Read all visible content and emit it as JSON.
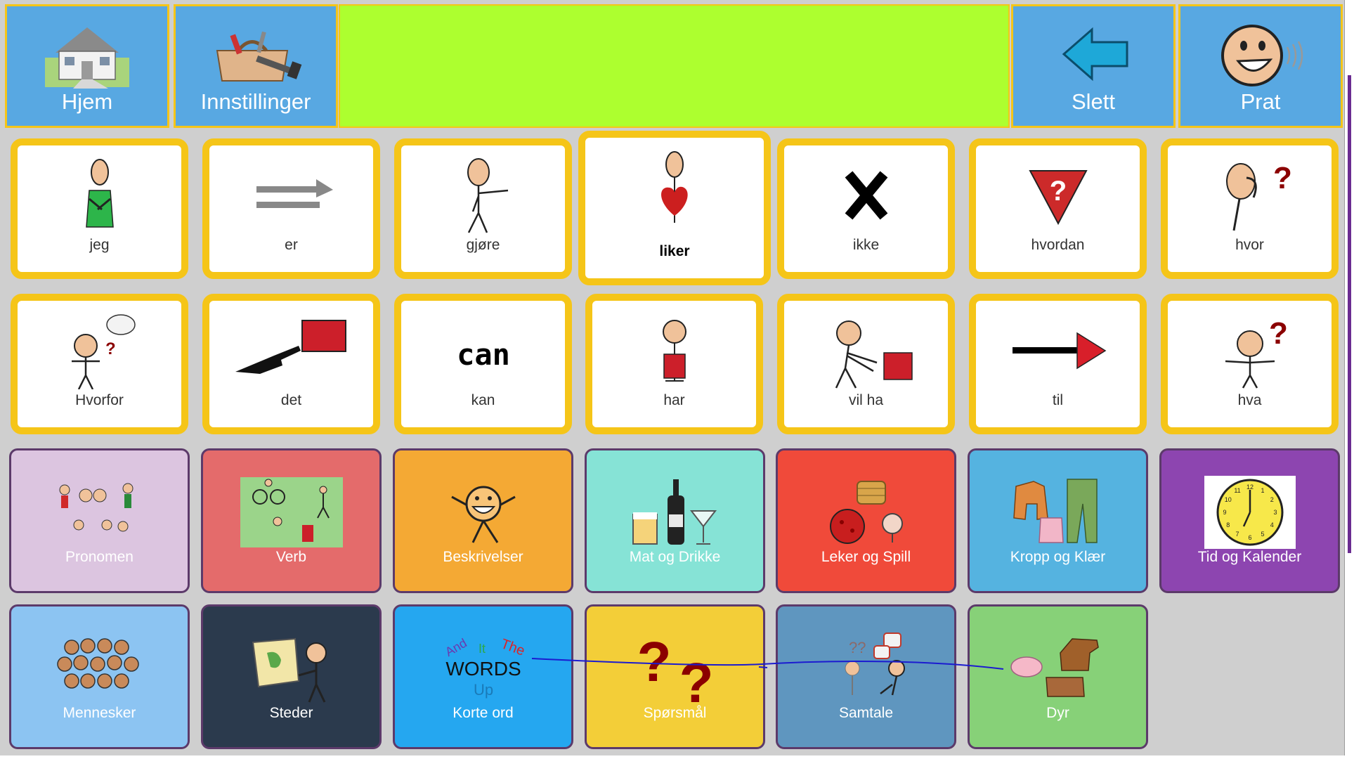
{
  "top_bar": {
    "home_label": "Hjem",
    "settings_label": "Innstillinger",
    "delete_label": "Slett",
    "speak_label": "Prat",
    "message_text": "",
    "colors": {
      "button": "#58a8e2",
      "message_bar": "#adff2f",
      "border": "#f5c518"
    }
  },
  "word_row_1": [
    {
      "label": "jeg",
      "icon": "person-self-icon"
    },
    {
      "label": "er",
      "icon": "equals-arrow-icon"
    },
    {
      "label": "gjøre",
      "icon": "person-doing-icon"
    },
    {
      "label": "liker",
      "icon": "person-heart-icon",
      "selected": true
    },
    {
      "label": "ikke",
      "icon": "cross-icon"
    },
    {
      "label": "hvordan",
      "icon": "question-triangle-icon"
    },
    {
      "label": "hvor",
      "icon": "person-question-icon"
    }
  ],
  "word_row_2": [
    {
      "label": "Hvorfor",
      "icon": "person-speech-question-icon"
    },
    {
      "label": "det",
      "icon": "pointing-hand-icon"
    },
    {
      "label": "kan",
      "icon": "can-text-icon",
      "symbol_text": "can"
    },
    {
      "label": "har",
      "icon": "person-holding-box-icon"
    },
    {
      "label": "vil ha",
      "icon": "person-reaching-box-icon"
    },
    {
      "label": "til",
      "icon": "arrow-right-icon"
    },
    {
      "label": "hva",
      "icon": "person-shrug-question-icon"
    }
  ],
  "categories_row_1": [
    {
      "label": "Pronomen",
      "icon": "people-group-icon",
      "color": "#dcc5e0"
    },
    {
      "label": "Verb",
      "icon": "actions-scene-icon",
      "color": "#e46b6b"
    },
    {
      "label": "Beskrivelser",
      "icon": "happy-face-icon",
      "color": "#f4a934"
    },
    {
      "label": "Mat og Drikke",
      "icon": "drinks-icon",
      "color": "#86e3d6"
    },
    {
      "label": "Leker og Spill",
      "icon": "toys-icon",
      "color": "#f04a3a"
    },
    {
      "label": "Kropp og Klær",
      "icon": "clothes-icon",
      "color": "#55b3e0"
    },
    {
      "label": "Tid og Kalender",
      "icon": "clock-icon",
      "color": "#8d45b0"
    }
  ],
  "categories_row_2": [
    {
      "label": "Mennesker",
      "icon": "crowd-icon",
      "color": "#8cc4f2"
    },
    {
      "label": "Steder",
      "icon": "map-person-icon",
      "color": "#2b3a4d"
    },
    {
      "label": "Korte ord",
      "icon": "words-icon",
      "color": "#25a7f0",
      "symbol_words": [
        "And",
        "It",
        "The",
        "WORDS",
        "Up"
      ]
    },
    {
      "label": "Spørsmål",
      "icon": "question-marks-icon",
      "color": "#f3ce38"
    },
    {
      "label": "Samtale",
      "icon": "conversation-icon",
      "color": "#5f96bf"
    },
    {
      "label": "Dyr",
      "icon": "animals-icon",
      "color": "#87d178"
    }
  ],
  "clock_numbers": [
    "12",
    "1",
    "2",
    "3",
    "4",
    "5",
    "6",
    "7",
    "8",
    "9",
    "10",
    "11"
  ]
}
